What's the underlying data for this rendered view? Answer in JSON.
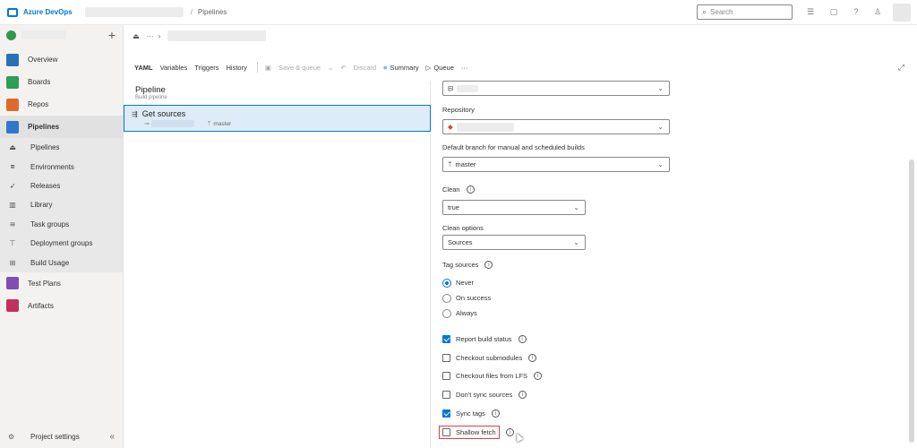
{
  "topbar": {
    "brand": "Azure DevOps",
    "breadcrumb_sep": "/",
    "breadcrumb_page": "Pipelines",
    "search_placeholder": "Search"
  },
  "sidebar": {
    "items": [
      {
        "label": "Overview",
        "color": "#2b6fb5"
      },
      {
        "label": "Boards",
        "color": "#2e9e58"
      },
      {
        "label": "Repos",
        "color": "#e06a2c"
      },
      {
        "label": "Pipelines",
        "color": "#2f78c8"
      }
    ],
    "subitems": [
      {
        "label": "Pipelines",
        "icon": "pipelines-icon"
      },
      {
        "label": "Environments",
        "icon": "environments-icon"
      },
      {
        "label": "Releases",
        "icon": "releases-icon"
      },
      {
        "label": "Library",
        "icon": "library-icon"
      },
      {
        "label": "Task groups",
        "icon": "task-groups-icon"
      },
      {
        "label": "Deployment groups",
        "icon": "deployment-groups-icon"
      },
      {
        "label": "Build Usage",
        "icon": "build-usage-icon"
      }
    ],
    "lower_items": [
      {
        "label": "Test Plans",
        "color": "#7d4fb3"
      },
      {
        "label": "Artifacts",
        "color": "#c4305e"
      }
    ],
    "project_settings": "Project settings"
  },
  "toolbar": {
    "tabs": [
      "YAML",
      "Variables",
      "Triggers",
      "History"
    ],
    "save_queue": "Save & queue",
    "discard": "Discard",
    "summary": "Summary",
    "queue": "Queue",
    "more": "···"
  },
  "left_pane": {
    "title": "Pipeline",
    "subtitle": "Build pipeline",
    "get_sources": "Get sources",
    "branch": "master"
  },
  "form": {
    "repository_label": "Repository",
    "default_branch_label": "Default branch for manual and scheduled builds",
    "default_branch_value": "master",
    "clean_label": "Clean",
    "clean_value": "true",
    "clean_options_label": "Clean options",
    "clean_options_value": "Sources",
    "tag_sources_label": "Tag sources",
    "tag_options": [
      {
        "label": "Never",
        "selected": true
      },
      {
        "label": "On success",
        "selected": false
      },
      {
        "label": "Always",
        "selected": false
      }
    ],
    "checkboxes": [
      {
        "label": "Report build status",
        "checked": true
      },
      {
        "label": "Checkout submodules",
        "checked": false
      },
      {
        "label": "Checkout files from LFS",
        "checked": false
      },
      {
        "label": "Don't sync sources",
        "checked": false
      },
      {
        "label": "Sync tags",
        "checked": true
      },
      {
        "label": "Shallow fetch",
        "checked": false
      }
    ]
  }
}
